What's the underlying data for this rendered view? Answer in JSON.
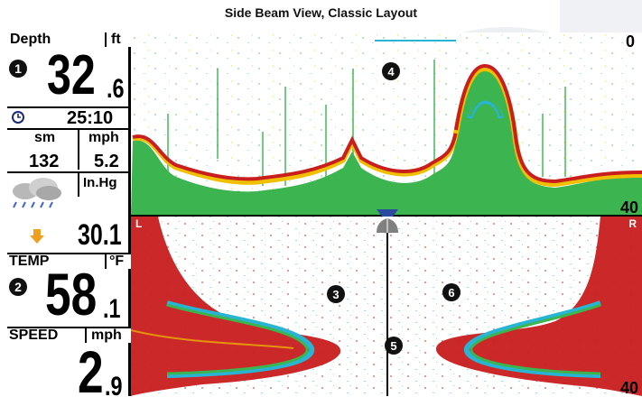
{
  "title": "Side Beam View, Classic Layout",
  "panel": {
    "depth_label": "Depth",
    "depth_unit": "ft",
    "depth_int": "32",
    "depth_dec": ".6",
    "time": "25:10",
    "dist_unit": "sm",
    "speed_unit1": "mph",
    "dist_val": "132",
    "speed_val1": "5.2",
    "pressure_unit": "In.Hg",
    "pressure_val": "30.1",
    "temp_label": "TEMP",
    "temp_unit": "°F",
    "temp_int": "58",
    "temp_dec": ".1",
    "speed_label": "SPEED",
    "speed_unit2": "mph",
    "speed_int": "2",
    "speed_dec": ".9"
  },
  "callouts": {
    "c1": "1",
    "c2": "2",
    "c3": "3",
    "c4": "4",
    "c5": "5",
    "c6": "6"
  },
  "sonar": {
    "top_range_start": "0",
    "top_range_end": "40",
    "side_left": "L",
    "side_right": "R",
    "side_range_end": "40"
  },
  "colors": {
    "red": "#c81e1e",
    "yellow": "#f0c000",
    "green": "#3cb450",
    "cyan": "#28b4d2",
    "arrow": "#f0a020"
  }
}
